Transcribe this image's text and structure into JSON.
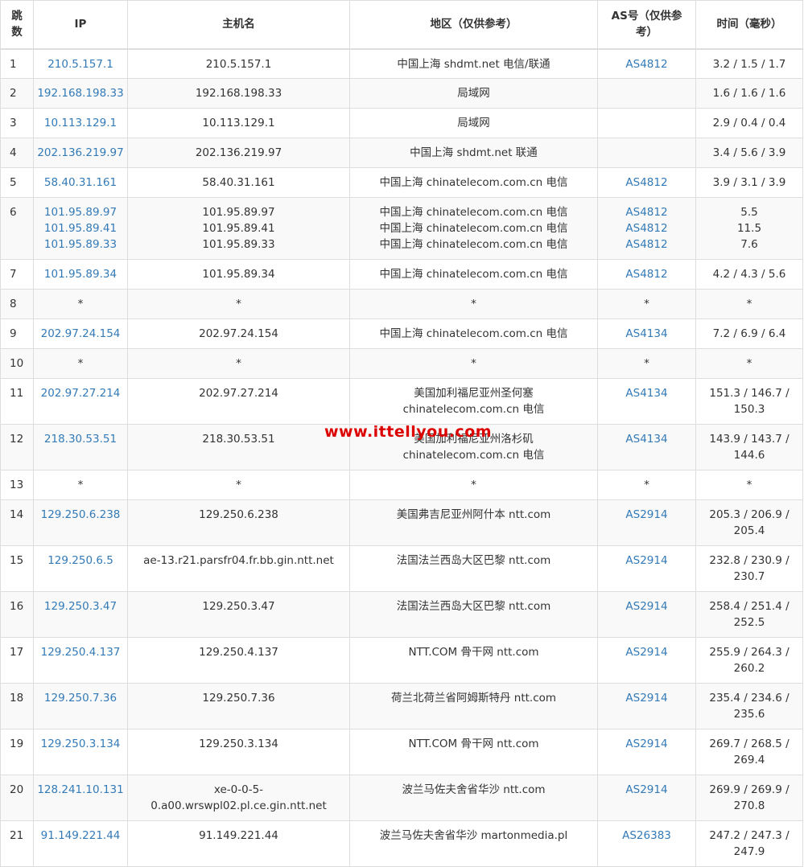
{
  "headers": {
    "hop": [
      "跳",
      "数"
    ],
    "ip": "IP",
    "hostname": "主机名",
    "location": "地区（仅供参考）",
    "as": [
      "AS号（仅供参",
      "考）"
    ],
    "time": "时间（毫秒）"
  },
  "watermark": "www.ittellyou.com",
  "colors": {
    "link": "#337ab7",
    "watermark": "#dd0000",
    "stripe": "#f9f9f9",
    "border": "#dddddd"
  },
  "rows": [
    {
      "hop": "1",
      "ip": [
        "210.5.157.1"
      ],
      "host": [
        "210.5.157.1"
      ],
      "loc": [
        "中国上海 shdmt.net 电信/联通"
      ],
      "as": [
        "AS4812"
      ],
      "time": [
        "3.2 / 1.5 / 1.7"
      ]
    },
    {
      "hop": "2",
      "ip": [
        "192.168.198.33"
      ],
      "host": [
        "192.168.198.33"
      ],
      "loc": [
        "局域网"
      ],
      "as": [
        ""
      ],
      "time": [
        "1.6 / 1.6 / 1.6"
      ]
    },
    {
      "hop": "3",
      "ip": [
        "10.113.129.1"
      ],
      "host": [
        "10.113.129.1"
      ],
      "loc": [
        "局域网"
      ],
      "as": [
        ""
      ],
      "time": [
        "2.9 / 0.4 / 0.4"
      ]
    },
    {
      "hop": "4",
      "ip": [
        "202.136.219.97"
      ],
      "host": [
        "202.136.219.97"
      ],
      "loc": [
        "中国上海 shdmt.net 联通"
      ],
      "as": [
        ""
      ],
      "time": [
        "3.4 / 5.6 / 3.9"
      ]
    },
    {
      "hop": "5",
      "ip": [
        "58.40.31.161"
      ],
      "host": [
        "58.40.31.161"
      ],
      "loc": [
        "中国上海 chinatelecom.com.cn 电信"
      ],
      "as": [
        "AS4812"
      ],
      "time": [
        "3.9 / 3.1 / 3.9"
      ]
    },
    {
      "hop": "6",
      "ip": [
        "101.95.89.97",
        "101.95.89.41",
        "101.95.89.33"
      ],
      "host": [
        "101.95.89.97",
        "101.95.89.41",
        "101.95.89.33"
      ],
      "loc": [
        "中国上海 chinatelecom.com.cn 电信",
        "中国上海 chinatelecom.com.cn 电信",
        "中国上海 chinatelecom.com.cn 电信"
      ],
      "as": [
        "AS4812",
        "AS4812",
        "AS4812"
      ],
      "time": [
        "5.5",
        "11.5",
        "7.6"
      ]
    },
    {
      "hop": "7",
      "ip": [
        "101.95.89.34"
      ],
      "host": [
        "101.95.89.34"
      ],
      "loc": [
        "中国上海 chinatelecom.com.cn 电信"
      ],
      "as": [
        "AS4812"
      ],
      "time": [
        "4.2 / 4.3 / 5.6"
      ]
    },
    {
      "hop": "8",
      "ip": [
        "*"
      ],
      "host": [
        "*"
      ],
      "loc": [
        "*"
      ],
      "as": [
        "*"
      ],
      "time": [
        "*"
      ]
    },
    {
      "hop": "9",
      "ip": [
        "202.97.24.154"
      ],
      "host": [
        "202.97.24.154"
      ],
      "loc": [
        "中国上海 chinatelecom.com.cn 电信"
      ],
      "as": [
        "AS4134"
      ],
      "time": [
        "7.2 / 6.9 / 6.4"
      ]
    },
    {
      "hop": "10",
      "ip": [
        "*"
      ],
      "host": [
        "*"
      ],
      "loc": [
        "*"
      ],
      "as": [
        "*"
      ],
      "time": [
        "*"
      ]
    },
    {
      "hop": "11",
      "ip": [
        "202.97.27.214"
      ],
      "host": [
        "202.97.27.214"
      ],
      "loc": [
        "美国加利福尼亚州圣何塞",
        "chinatelecom.com.cn 电信"
      ],
      "as": [
        "AS4134"
      ],
      "time": [
        "151.3 / 146.7 /",
        "150.3"
      ]
    },
    {
      "hop": "12",
      "ip": [
        "218.30.53.51"
      ],
      "host": [
        "218.30.53.51"
      ],
      "loc": [
        "美国加利福尼亚州洛杉矶",
        "chinatelecom.com.cn 电信"
      ],
      "as": [
        "AS4134"
      ],
      "time": [
        "143.9 / 143.7 /",
        "144.6"
      ]
    },
    {
      "hop": "13",
      "ip": [
        "*"
      ],
      "host": [
        "*"
      ],
      "loc": [
        "*"
      ],
      "as": [
        "*"
      ],
      "time": [
        "*"
      ]
    },
    {
      "hop": "14",
      "ip": [
        "129.250.6.238"
      ],
      "host": [
        "129.250.6.238"
      ],
      "loc": [
        "美国弗吉尼亚州阿什本 ntt.com"
      ],
      "as": [
        "AS2914"
      ],
      "time": [
        "205.3 / 206.9 /",
        "205.4"
      ]
    },
    {
      "hop": "15",
      "ip": [
        "129.250.6.5"
      ],
      "host": [
        "ae-13.r21.parsfr04.fr.bb.gin.ntt.net"
      ],
      "loc": [
        "法国法兰西岛大区巴黎 ntt.com"
      ],
      "as": [
        "AS2914"
      ],
      "time": [
        "232.8 / 230.9 /",
        "230.7"
      ]
    },
    {
      "hop": "16",
      "ip": [
        "129.250.3.47"
      ],
      "host": [
        "129.250.3.47"
      ],
      "loc": [
        "法国法兰西岛大区巴黎 ntt.com"
      ],
      "as": [
        "AS2914"
      ],
      "time": [
        "258.4 / 251.4 /",
        "252.5"
      ]
    },
    {
      "hop": "17",
      "ip": [
        "129.250.4.137"
      ],
      "host": [
        "129.250.4.137"
      ],
      "loc": [
        "NTT.COM 骨干网 ntt.com"
      ],
      "as": [
        "AS2914"
      ],
      "time": [
        "255.9 / 264.3 /",
        "260.2"
      ]
    },
    {
      "hop": "18",
      "ip": [
        "129.250.7.36"
      ],
      "host": [
        "129.250.7.36"
      ],
      "loc": [
        "荷兰北荷兰省阿姆斯特丹 ntt.com"
      ],
      "as": [
        "AS2914"
      ],
      "time": [
        "235.4 / 234.6 /",
        "235.6"
      ]
    },
    {
      "hop": "19",
      "ip": [
        "129.250.3.134"
      ],
      "host": [
        "129.250.3.134"
      ],
      "loc": [
        "NTT.COM 骨干网 ntt.com"
      ],
      "as": [
        "AS2914"
      ],
      "time": [
        "269.7 / 268.5 /",
        "269.4"
      ]
    },
    {
      "hop": "20",
      "ip": [
        "128.241.10.131"
      ],
      "host": [
        "xe-0-0-5-",
        "0.a00.wrswpl02.pl.ce.gin.ntt.net"
      ],
      "loc": [
        "波兰马佐夫舍省华沙 ntt.com"
      ],
      "as": [
        "AS2914"
      ],
      "time": [
        "269.9 / 269.9 /",
        "270.8"
      ]
    },
    {
      "hop": "21",
      "ip": [
        "91.149.221.44"
      ],
      "host": [
        "91.149.221.44"
      ],
      "loc": [
        "波兰马佐夫舍省华沙 martonmedia.pl"
      ],
      "as": [
        "AS26383"
      ],
      "time": [
        "247.2 / 247.3 /",
        "247.9"
      ]
    }
  ]
}
